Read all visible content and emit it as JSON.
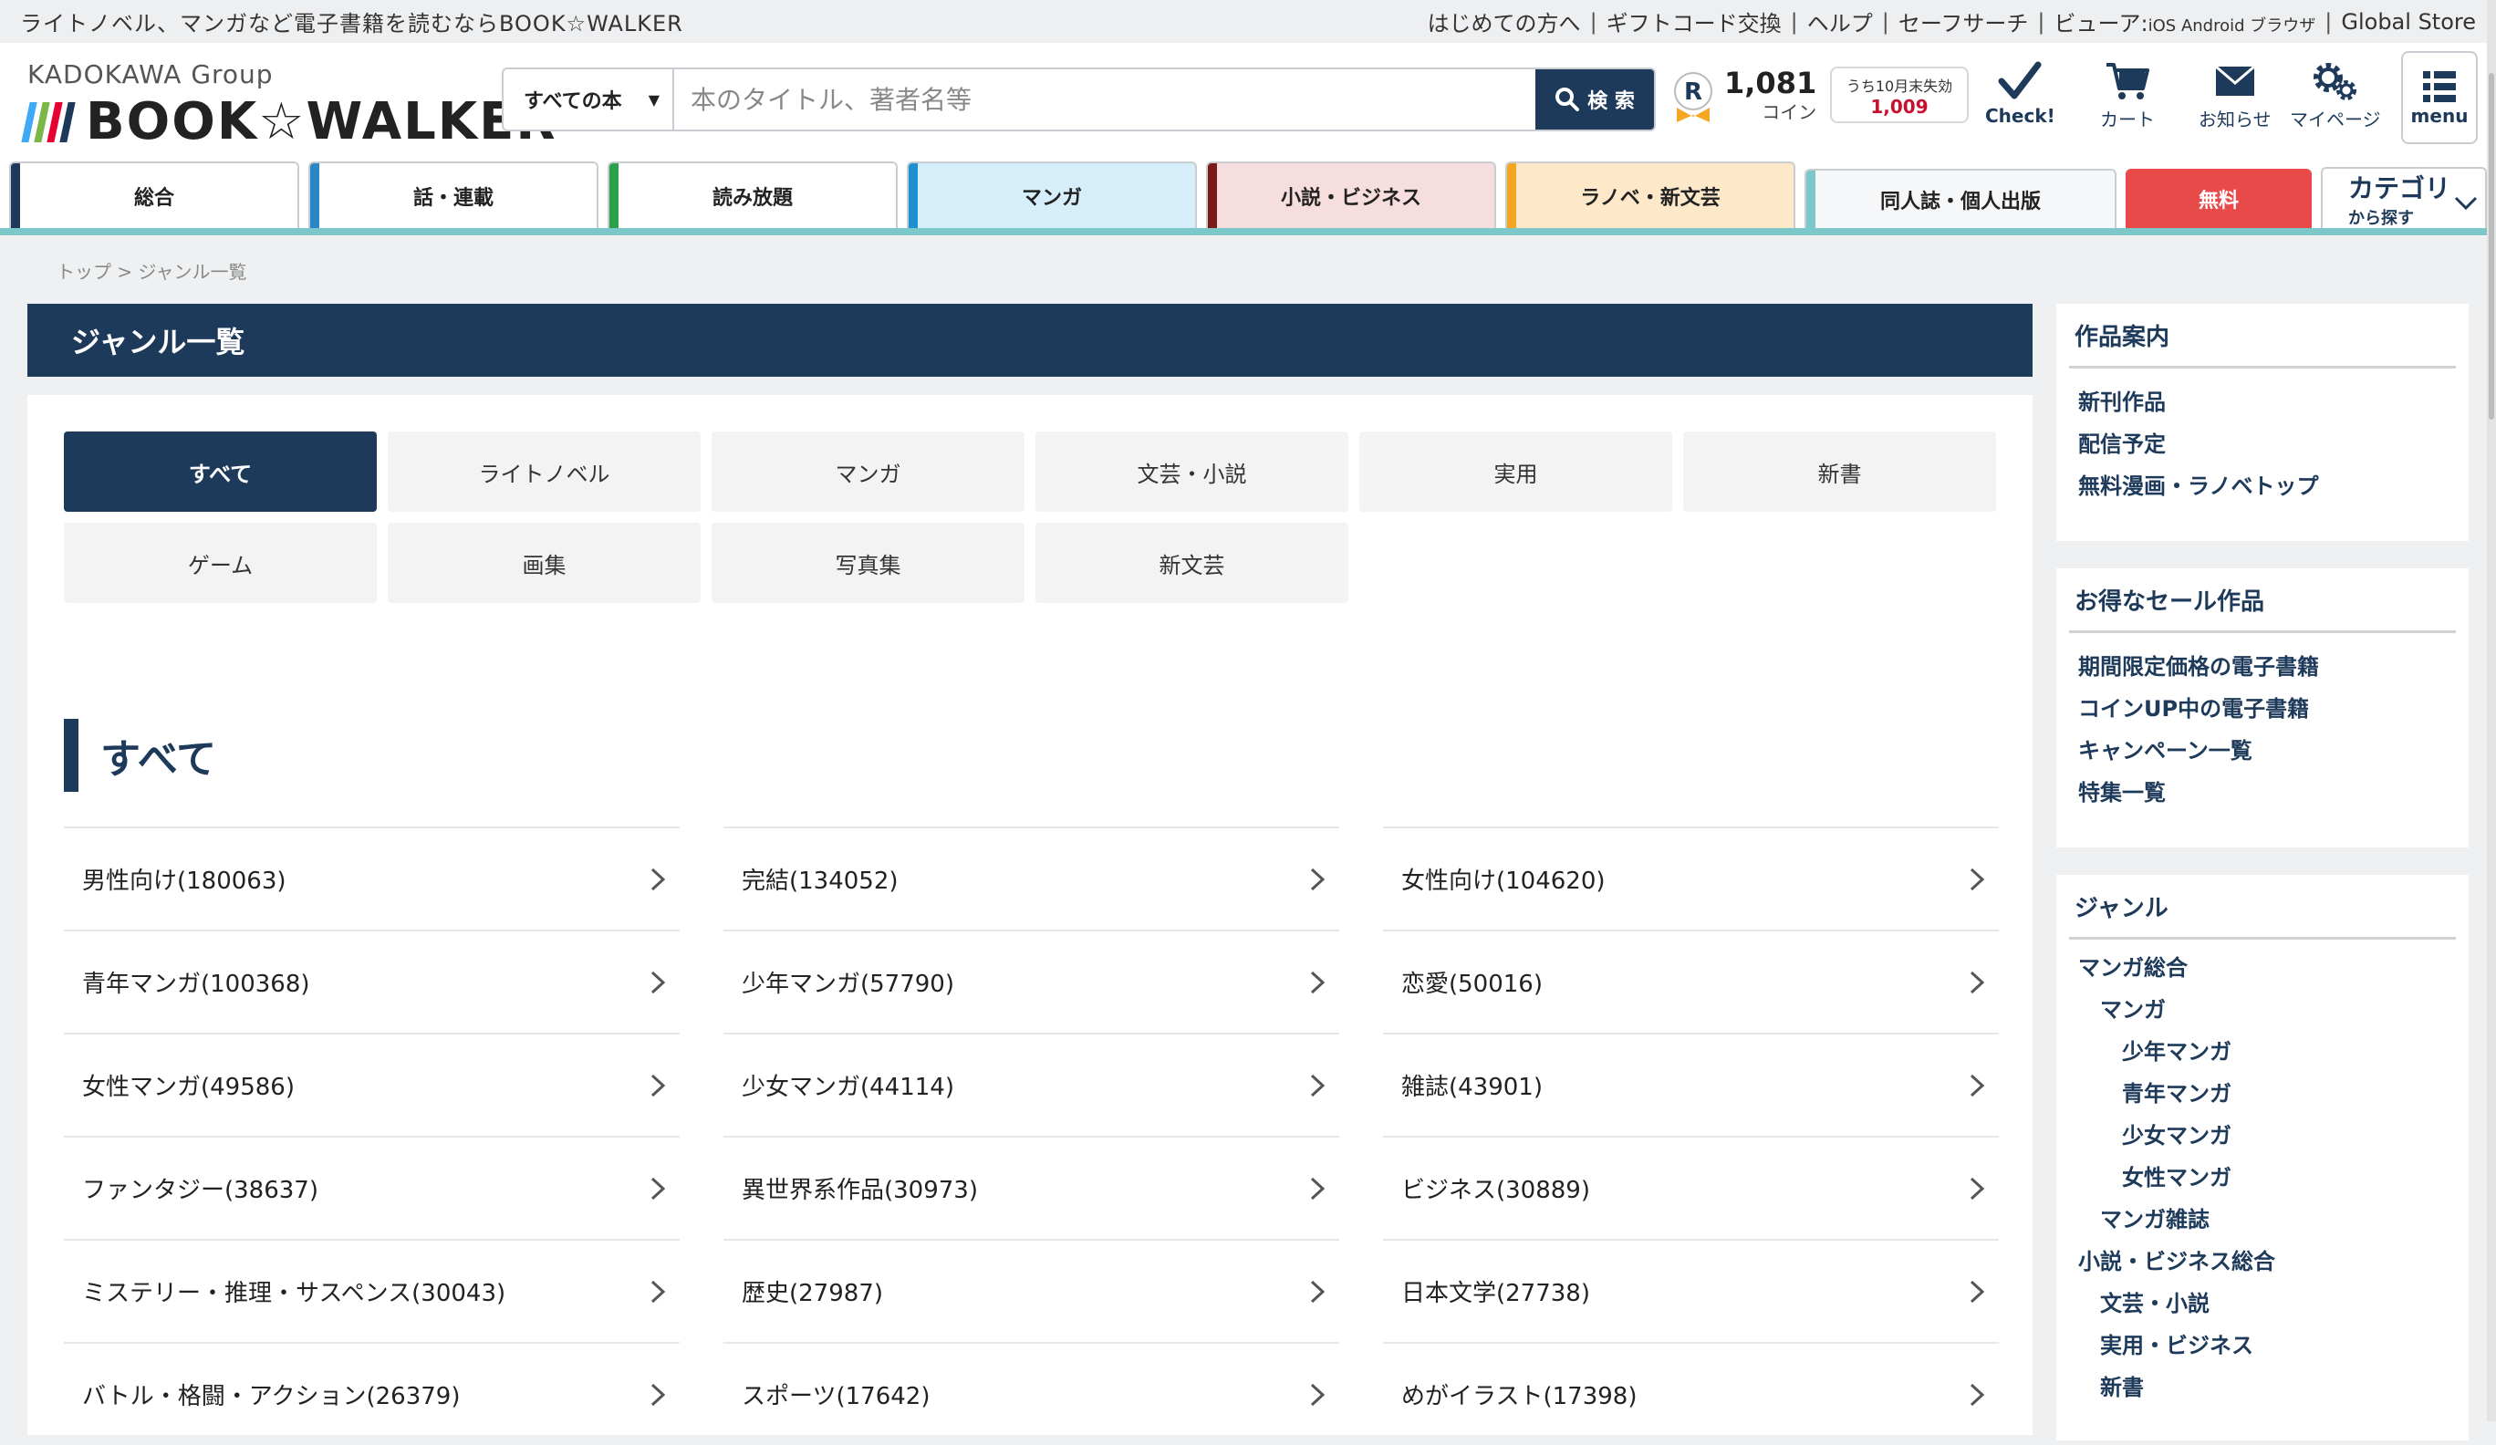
{
  "topbar": {
    "tagline": "ライトノベル、マンガなど電子書籍を読むならBOOK☆WALKER",
    "links": [
      "はじめての方へ",
      "ギフトコード交換",
      "ヘルプ",
      "セーフサーチ"
    ],
    "viewer_label": "ビューア:",
    "viewer_platforms": "iOS Android ブラウザ",
    "global_store": "Global Store"
  },
  "header": {
    "group": "KADOKAWA Group",
    "brand": "BOOK☆WALKER",
    "logo_colors": [
      "#3fa9f5",
      "#7ab648",
      "#e60033",
      "#1e3a5a"
    ],
    "search_scope": "すべての本",
    "search_placeholder": "本のタイトル、著者名等",
    "search_button": "検 索",
    "coin_amount": "1,081",
    "coin_unit": "コイン",
    "expire_label": "うち10月末失効",
    "expire_value": "1,009",
    "icons": {
      "check": "Check!",
      "cart": "カート",
      "notice": "お知らせ",
      "mypage": "マイページ",
      "menu": "menu"
    }
  },
  "nav": {
    "tabs": [
      {
        "label": "総合",
        "color": "#1e3a5a",
        "bg": "#ffffff"
      },
      {
        "label": "話・連載",
        "color": "#2b86c5",
        "bg": "#ffffff"
      },
      {
        "label": "読み放題",
        "color": "#2aa04a",
        "bg": "#ffffff"
      },
      {
        "label": "マンガ",
        "color": "#1e8fd0",
        "bg": "#d6eefa"
      },
      {
        "label": "小説・ビジネス",
        "color": "#7a1a1a",
        "bg": "#f6dede"
      },
      {
        "label": "ラノベ・新文芸",
        "color": "#f5a623",
        "bg": "#fde9c9"
      },
      {
        "label": "同人誌・個人出版",
        "color": "#7cc7c9",
        "bg": "#f6f7f8"
      }
    ],
    "free": "無料",
    "free_color": "#e84a4a",
    "category_main": "カテゴリ",
    "category_sub": "から探す"
  },
  "breadcrumb": "トップ > ジャンル一覧",
  "main": {
    "title": "ジャンル一覧",
    "genre_buttons": [
      "すべて",
      "ライトノベル",
      "マンガ",
      "文芸・小説",
      "実用",
      "新書",
      "ゲーム",
      "画集",
      "写真集",
      "新文芸"
    ],
    "active_index": 0,
    "section_title": "すべて",
    "items": [
      "男性向け(180063)",
      "完結(134052)",
      "女性向け(104620)",
      "青年マンガ(100368)",
      "少年マンガ(57790)",
      "恋愛(50016)",
      "女性マンガ(49586)",
      "少女マンガ(44114)",
      "雑誌(43901)",
      "ファンタジー(38637)",
      "異世界系作品(30973)",
      "ビジネス(30889)",
      "ミステリー・推理・サスペンス(30043)",
      "歴史(27987)",
      "日本文学(27738)",
      "バトル・格闘・アクション(26379)",
      "スポーツ(17642)",
      "めがイラスト(17398)"
    ]
  },
  "sidebar": {
    "works": {
      "title": "作品案内",
      "links": [
        "新刊作品",
        "配信予定",
        "無料漫画・ラノベトップ"
      ]
    },
    "sale": {
      "title": "お得なセール作品",
      "links": [
        "期間限定価格の電子書籍",
        "コインUP中の電子書籍",
        "キャンペーン一覧",
        "特集一覧"
      ]
    },
    "genre": {
      "title": "ジャンル",
      "links": [
        {
          "label": "マンガ総合",
          "level": 0
        },
        {
          "label": "マンガ",
          "level": 1
        },
        {
          "label": "少年マンガ",
          "level": 2
        },
        {
          "label": "青年マンガ",
          "level": 2
        },
        {
          "label": "少女マンガ",
          "level": 2
        },
        {
          "label": "女性マンガ",
          "level": 2
        },
        {
          "label": "マンガ雑誌",
          "level": 1
        },
        {
          "label": "小説・ビジネス総合",
          "level": 0
        },
        {
          "label": "文芸・小説",
          "level": 1
        },
        {
          "label": "実用・ビジネス",
          "level": 1
        },
        {
          "label": "新書",
          "level": 1
        }
      ]
    }
  }
}
